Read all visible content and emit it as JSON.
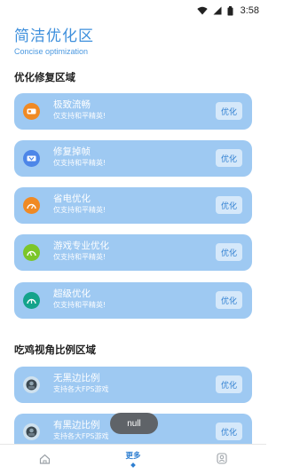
{
  "status_bar": {
    "time": "3:58",
    "icons": [
      "wifi-icon",
      "signal-icon",
      "battery-icon"
    ]
  },
  "header": {
    "title": "简洁优化区",
    "subtitle": "Concise optimization"
  },
  "sections": [
    {
      "title": "优化修复区域",
      "items": [
        {
          "title": "极致流畅",
          "desc": "仅支持和平精英!",
          "icon": "smooth-icon",
          "icon_color": "#f08a24",
          "button": "优化"
        },
        {
          "title": "修复掉帧",
          "desc": "仅支持和平精英!",
          "icon": "frame-fix-icon",
          "icon_color": "#4d86e8",
          "button": "优化"
        },
        {
          "title": "省电优化",
          "desc": "仅支持和平精英!",
          "icon": "power-save-icon",
          "icon_color": "#f08a24",
          "button": "优化"
        },
        {
          "title": "游戏专业优化",
          "desc": "仅支持和平精英!",
          "icon": "game-pro-icon",
          "icon_color": "#7cc629",
          "button": "优化"
        },
        {
          "title": "超级优化",
          "desc": "仅支持和平精英!",
          "icon": "super-opt-icon",
          "icon_color": "#14a38b",
          "button": "优化"
        }
      ]
    },
    {
      "title": "吃鸡视角比例区域",
      "items": [
        {
          "title": "无黑边比例",
          "desc": "支持各大FPS游戏",
          "icon": "game-avatar-icon",
          "icon_color": "#6b7b86",
          "button": "优化"
        },
        {
          "title": "有黑边比例",
          "desc": "支持各大FPS游戏",
          "icon": "game-avatar-icon",
          "icon_color": "#6b7b86",
          "button": "优化"
        }
      ]
    }
  ],
  "toast": "null",
  "bottom_nav": {
    "items": [
      {
        "label": "",
        "icon": "home-icon"
      },
      {
        "label": "更多",
        "icon": "diamond-indicator",
        "active": true
      },
      {
        "label": "",
        "icon": "user-icon"
      }
    ]
  },
  "colors": {
    "accent": "#3d8fdc",
    "card_bg": "#9ec9f2",
    "button_bg": "#d5e8fa"
  }
}
